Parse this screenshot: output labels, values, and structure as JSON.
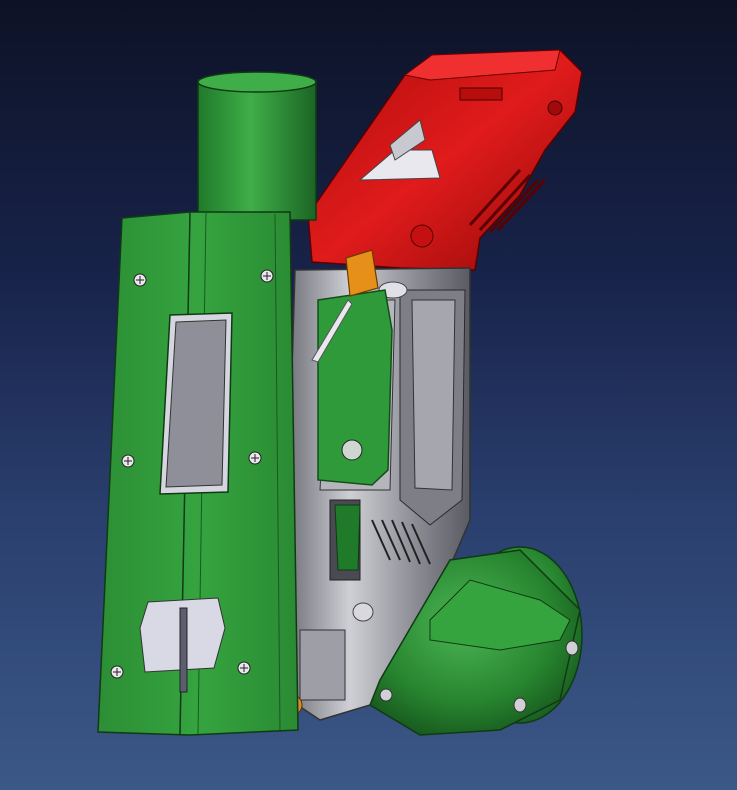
{
  "scene": {
    "subject": "cad-model",
    "colors": {
      "background_top": "#0d1226",
      "background_bottom": "#3b5887",
      "green_part": "#2f9a3a",
      "green_dark": "#1f6e28",
      "red_part": "#d41414",
      "grey_body": "#9a9aa2",
      "orange_part": "#e6901a"
    },
    "icons": [
      "screw-icon"
    ]
  }
}
